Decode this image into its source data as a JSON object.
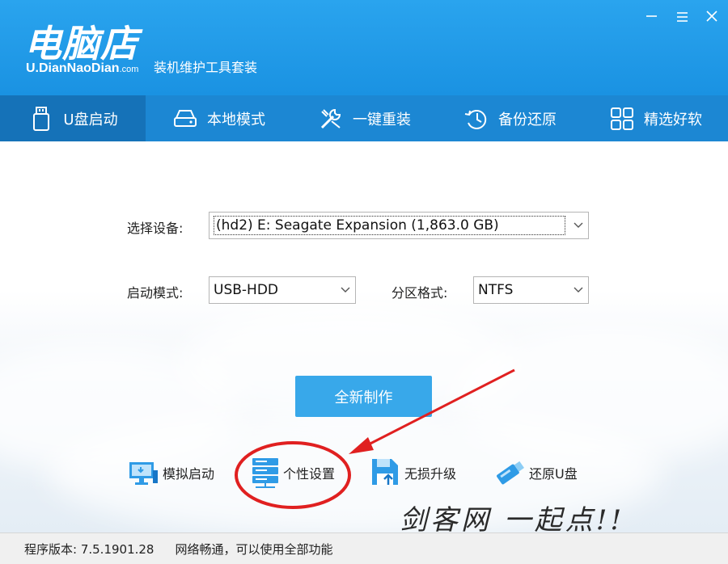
{
  "app": {
    "logo_main": "电脑店",
    "logo_sub": "U.DianNaoDian",
    "logo_sub_suffix": ".com",
    "tagline": "装机维护工具套装"
  },
  "window_controls": [
    "minimize-icon",
    "menu-icon",
    "close-icon"
  ],
  "nav": {
    "items": [
      {
        "label": "U盘启动",
        "icon": "usb-drive-icon",
        "active": true
      },
      {
        "label": "本地模式",
        "icon": "hard-disk-icon",
        "active": false
      },
      {
        "label": "一键重装",
        "icon": "tools-icon",
        "active": false
      },
      {
        "label": "备份还原",
        "icon": "restore-clock-icon",
        "active": false
      },
      {
        "label": "精选好软",
        "icon": "apps-grid-icon",
        "active": false
      }
    ]
  },
  "form": {
    "device_label": "选择设备:",
    "device_value": "(hd2) E: Seagate Expansion (1,863.0 GB)",
    "boot_mode_label": "启动模式:",
    "boot_mode_value": "USB-HDD",
    "partition_label": "分区格式:",
    "partition_value": "NTFS"
  },
  "make_button": "全新制作",
  "tools": [
    {
      "label": "模拟启动",
      "icon": "monitor-boot-icon"
    },
    {
      "label": "个性设置",
      "icon": "server-settings-icon"
    },
    {
      "label": "无损升级",
      "icon": "floppy-upgrade-icon"
    },
    {
      "label": "还原U盘",
      "icon": "usb-restore-icon"
    }
  ],
  "watermark": "剑客网  一起点!!",
  "status": {
    "version": "程序版本: 7.5.1901.28",
    "network": "网络畅通，可以使用全部功能"
  },
  "colors": {
    "header": "#1f98e6",
    "nav": "#1c87d3",
    "nav_active": "#1572b8",
    "primary_button": "#38a8ea",
    "annotation": "#e02020"
  }
}
